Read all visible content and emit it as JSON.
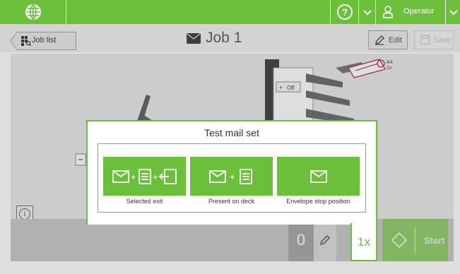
{
  "topbar": {
    "logo_icon": "globe-logo-icon",
    "help_icon": "help-circle-icon",
    "help_text": "?",
    "user_icon": "operator-user-icon",
    "operator_label": "Operator",
    "accent_color": "#6bbf3a"
  },
  "header": {
    "job_list_label": "Job list",
    "job_list_icon": "grid-search-icon",
    "job_title": "Job 1",
    "job_icon": "envelope-icon",
    "edit_label": "Edit",
    "edit_icon": "pencil-icon",
    "save_label": "Save",
    "save_icon": "save-disk-icon"
  },
  "machine": {
    "feeder_label": "Off",
    "feeder_label_prefix": "+",
    "stacker_tag_size": "A4",
    "stacker_tag_count": "1x"
  },
  "bottom": {
    "counter_value": "0",
    "counter_edit_icon": "pencil-icon",
    "start_label": "Start",
    "start_icon": "start-diamond-icon"
  },
  "popup": {
    "title": "Test mail set",
    "multiplier": "1x",
    "options": [
      {
        "label": "Selected exit",
        "icon": "envelope-plus-document-plus-exit-icon"
      },
      {
        "label": "Present on deck",
        "icon": "envelope-plus-document-icon"
      },
      {
        "label": "Envelope stop position",
        "icon": "envelope-icon"
      }
    ]
  }
}
